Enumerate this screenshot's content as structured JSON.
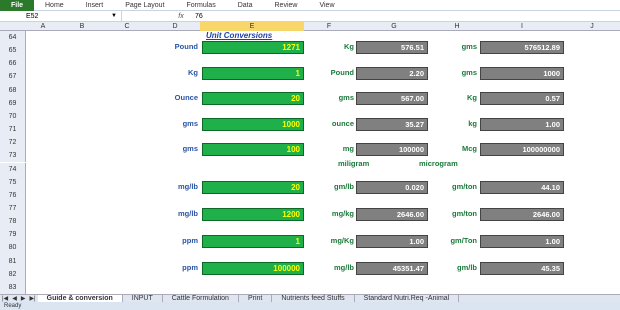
{
  "ribbon": {
    "file": "File",
    "tabs": [
      "Home",
      "Insert",
      "Page Layout",
      "Formulas",
      "Data",
      "Review",
      "View"
    ]
  },
  "formula_bar": {
    "name_box": "E52",
    "fx": "fx",
    "value": "76"
  },
  "columns": [
    "A",
    "B",
    "C",
    "D",
    "E",
    "F",
    "G",
    "H",
    "I",
    "J"
  ],
  "rows": [
    "64",
    "65",
    "66",
    "67",
    "68",
    "69",
    "70",
    "71",
    "72",
    "73",
    "74",
    "75",
    "76",
    "77",
    "78",
    "79",
    "80",
    "81",
    "82",
    "83"
  ],
  "title": "Unit Conversions",
  "conversions": [
    {
      "label": "Pound",
      "value": "1271",
      "unit1": "Kg",
      "val1": "576.51",
      "unit2": "gms",
      "val2": "576512.89"
    },
    {
      "label": "Kg",
      "value": "1",
      "unit1": "Pound",
      "val1": "2.20",
      "unit2": "gms",
      "val2": "1000"
    },
    {
      "label": "Ounce",
      "value": "20",
      "unit1": "gms",
      "val1": "567.00",
      "unit2": "Kg",
      "val2": "0.57"
    },
    {
      "label": "gms",
      "value": "1000",
      "unit1": "ounce",
      "val1": "35.27",
      "unit2": "kg",
      "val2": "1.00"
    },
    {
      "label": "gms",
      "value": "100",
      "unit1": "mg",
      "val1": "100000",
      "unit2": "Mcg",
      "val2": "100000000"
    },
    {
      "label": "mg/lb",
      "value": "20",
      "unit1": "gm/lb",
      "val1": "0.020",
      "unit2": "gm/ton",
      "val2": "44.10"
    },
    {
      "label": "mg/lb",
      "value": "1200",
      "unit1": "mg/kg",
      "val1": "2646.00",
      "unit2": "gm/ton",
      "val2": "2646.00"
    },
    {
      "label": "ppm",
      "value": "1",
      "unit1": "mg/Kg",
      "val1": "1.00",
      "unit2": "gm/Ton",
      "val2": "1.00"
    },
    {
      "label": "ppm",
      "value": "100000",
      "unit1": "mg/lb",
      "val1": "45351.47",
      "unit2": "gm/lb",
      "val2": "45.35"
    }
  ],
  "section_labels": {
    "milligram": "miligram",
    "microgram": "microgram"
  },
  "sheet_tabs": [
    "Guide & conversion",
    "INPUT",
    "Cattle Formulation",
    "Print",
    "Nutrients feed Stuffs",
    "Standard Nutri.Req -Animal"
  ],
  "status": "Ready"
}
